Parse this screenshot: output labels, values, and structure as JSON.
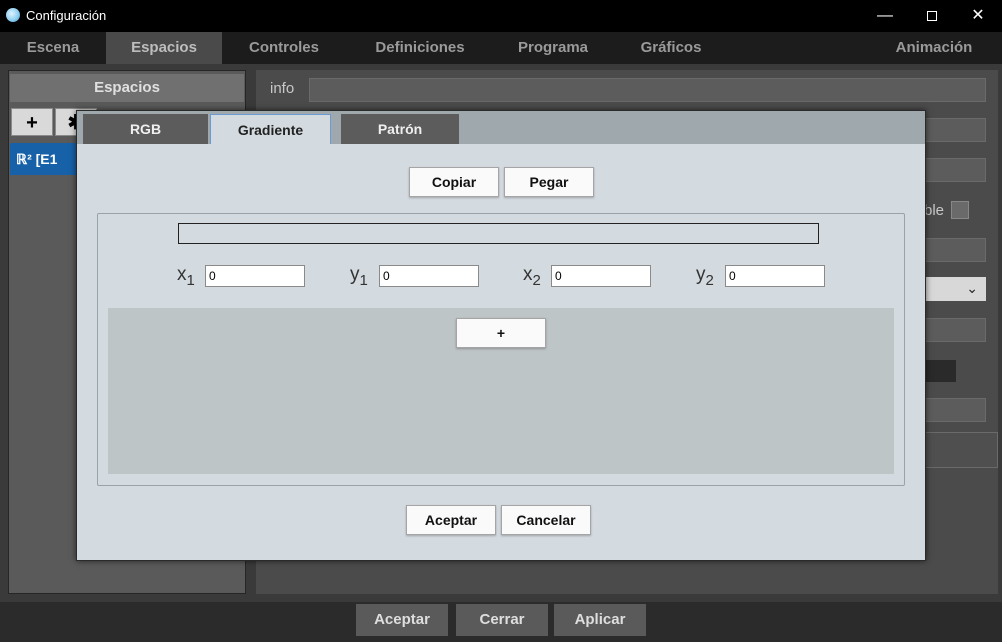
{
  "window": {
    "title": "Configuración",
    "minimize_glyph": "—",
    "close_glyph": "✕"
  },
  "main_tabs": [
    {
      "label": "Escena",
      "active": false
    },
    {
      "label": "Espacios",
      "active": true
    },
    {
      "label": "Controles",
      "active": false
    },
    {
      "label": "Definiciones",
      "active": false
    },
    {
      "label": "Programa",
      "active": false
    },
    {
      "label": "Gráficos",
      "active": false
    },
    {
      "label": "Animación",
      "active": false
    }
  ],
  "left_panel": {
    "header": "Espacios",
    "add_label": "+",
    "second_label": "✱",
    "space_item": "ℝ² [E1"
  },
  "right_panel": {
    "info_label": "info",
    "partial_label": "ble",
    "select_chevron": "⌄"
  },
  "bottom_buttons": {
    "accept": "Aceptar",
    "close": "Cerrar",
    "apply": "Aplicar"
  },
  "dialog": {
    "tabs": [
      {
        "label": "RGB",
        "active": false
      },
      {
        "label": "Gradiente",
        "active": true
      },
      {
        "label": "Patrón",
        "active": false
      }
    ],
    "copy_button": "Copiar",
    "paste_button": "Pegar",
    "coords": {
      "x1": {
        "var": "x",
        "sub": "1",
        "value": "0"
      },
      "y1": {
        "var": "y",
        "sub": "1",
        "value": "0"
      },
      "x2": {
        "var": "x",
        "sub": "2",
        "value": "0"
      },
      "y2": {
        "var": "y",
        "sub": "2",
        "value": "0"
      }
    },
    "add_stop_button": "+",
    "accept_button": "Aceptar",
    "cancel_button": "Cancelar"
  },
  "colors": {
    "accent": "#1761a8",
    "dialog_bg": "#d4dbe0",
    "active_tab_border": "#6b9bd2"
  },
  "icons": {
    "app": "app-logo-icon",
    "minimize": "minimize-icon",
    "maximize": "maximize-icon",
    "close": "close-icon"
  }
}
